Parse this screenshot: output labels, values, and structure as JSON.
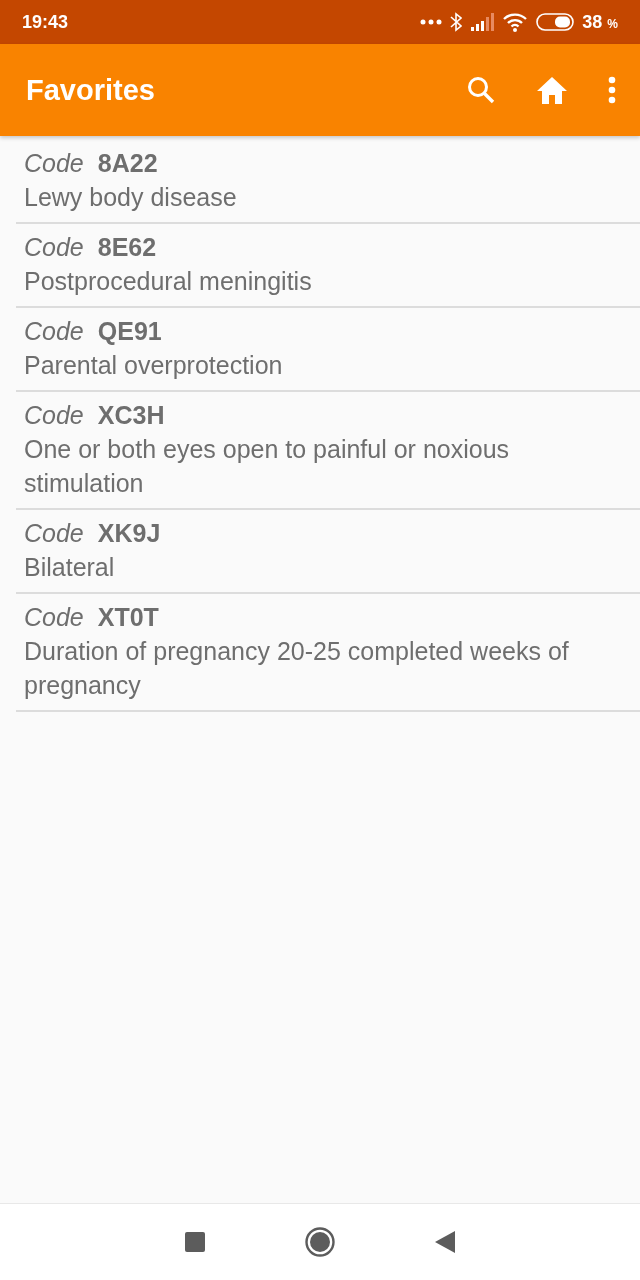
{
  "status_bar": {
    "time": "19:43",
    "battery": "38",
    "battery_unit": "%"
  },
  "app_bar": {
    "title": "Favorites"
  },
  "favorites": [
    {
      "label": "Code",
      "code": "8A22",
      "description": "Lewy body disease"
    },
    {
      "label": "Code",
      "code": "8E62",
      "description": "Postprocedural meningitis"
    },
    {
      "label": "Code",
      "code": "QE91",
      "description": "Parental overprotection"
    },
    {
      "label": "Code",
      "code": "XC3H",
      "description": "One or both eyes open to painful or noxious stimulation"
    },
    {
      "label": "Code",
      "code": "XK9J",
      "description": "Bilateral"
    },
    {
      "label": "Code",
      "code": "XT0T",
      "description": "Duration of pregnancy 20-25 completed weeks of pregnancy"
    }
  ]
}
